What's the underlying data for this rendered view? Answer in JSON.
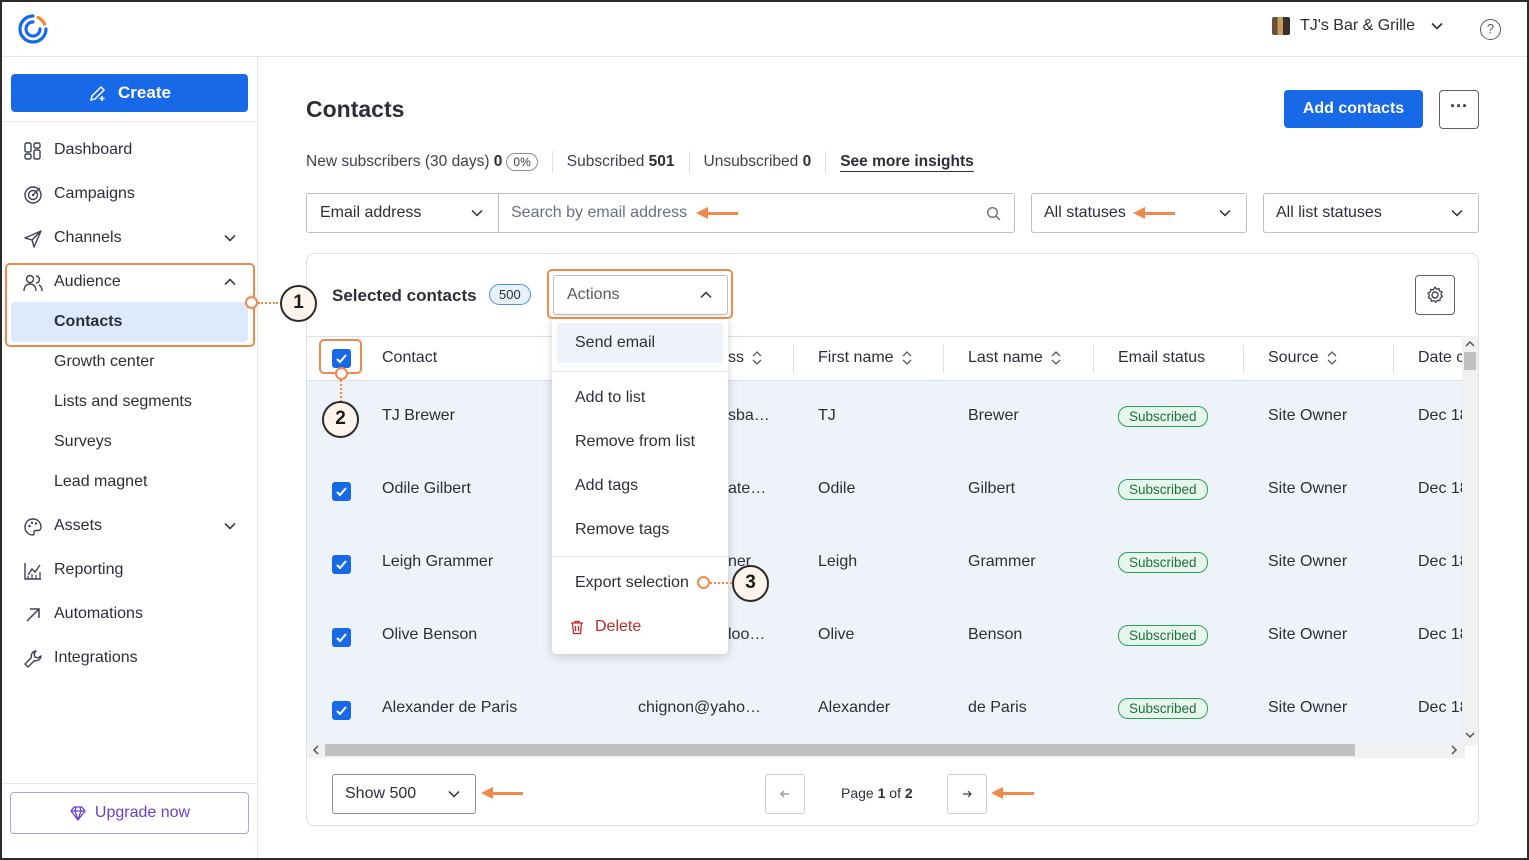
{
  "account": {
    "name": "TJ's Bar & Grille",
    "help_glyph": "?"
  },
  "sidebar": {
    "create_label": "Create",
    "items": [
      {
        "label": "Dashboard",
        "icon": "dashboard-icon"
      },
      {
        "label": "Campaigns",
        "icon": "target-icon"
      },
      {
        "label": "Channels",
        "icon": "send-icon"
      },
      {
        "label": "Audience",
        "icon": "people-icon"
      },
      {
        "label": "Contacts"
      },
      {
        "label": "Growth center"
      },
      {
        "label": "Lists and segments"
      },
      {
        "label": "Surveys"
      },
      {
        "label": "Lead magnet"
      },
      {
        "label": "Assets",
        "icon": "palette-icon"
      },
      {
        "label": "Reporting",
        "icon": "chart-icon"
      },
      {
        "label": "Automations",
        "icon": "arrow-up-right-icon"
      },
      {
        "label": "Integrations",
        "icon": "wrench-icon"
      }
    ],
    "upgrade_label": "Upgrade now"
  },
  "page": {
    "title": "Contacts",
    "add_contacts_label": "Add contacts",
    "more_glyph": "···"
  },
  "stats": {
    "new_label": "New subscribers (30 days)",
    "new_value": "0",
    "new_pct": "0%",
    "subscribed_label": "Subscribed",
    "subscribed_value": "501",
    "unsubscribed_label": "Unsubscribed",
    "unsubscribed_value": "0",
    "insights_link": "See more insights"
  },
  "filters": {
    "field_select": "Email address",
    "search_placeholder": "Search by email address",
    "status_select": "All statuses",
    "list_status_select": "All list statuses"
  },
  "table": {
    "selected_label": "Selected contacts",
    "selected_count": "500",
    "actions_label": "Actions",
    "columns": [
      "Contact",
      "ss",
      "First name",
      "Last name",
      "Email status",
      "Source",
      "Date c"
    ],
    "rows": [
      {
        "contact": "TJ Brewer",
        "email": "sba…",
        "first": "TJ",
        "last": "Brewer",
        "status": "Subscribed",
        "source": "Site Owner",
        "date": "Dec 18"
      },
      {
        "contact": "Odile Gilbert",
        "email": "ate…",
        "first": "Odile",
        "last": "Gilbert",
        "status": "Subscribed",
        "source": "Site Owner",
        "date": "Dec 18"
      },
      {
        "contact": "Leigh Grammer",
        "email": "ner",
        "first": "Leigh",
        "last": "Grammer",
        "status": "Subscribed",
        "source": "Site Owner",
        "date": "Dec 18"
      },
      {
        "contact": "Olive Benson",
        "email": "loo…",
        "first": "Olive",
        "last": "Benson",
        "status": "Subscribed",
        "source": "Site Owner",
        "date": "Dec 18"
      },
      {
        "contact": "Alexander de Paris",
        "email": "chignon@yaho…",
        "first": "Alexander",
        "last": "de Paris",
        "status": "Subscribed",
        "source": "Site Owner",
        "date": "Dec 18"
      }
    ],
    "show_label": "Show 500",
    "page_prefix": "Page",
    "page_current": "1",
    "page_of": "of",
    "page_total": "2"
  },
  "actions_menu": {
    "items": [
      "Send email",
      "Add to list",
      "Remove from list",
      "Add tags",
      "Remove tags",
      "Export selection",
      "Delete"
    ]
  },
  "annotations": {
    "step1": "1",
    "step2": "2",
    "step3": "3"
  },
  "colors": {
    "accent": "#1769e8",
    "annotation": "#f0894a",
    "success": "#29a35a",
    "danger": "#c62828",
    "upgrade": "#6b3fd4"
  }
}
